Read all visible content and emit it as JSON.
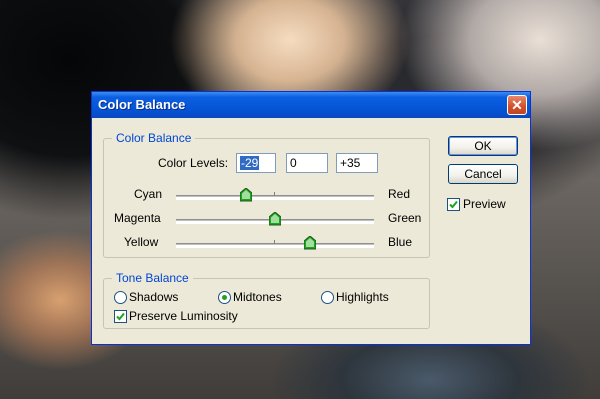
{
  "dialog": {
    "title": "Color Balance",
    "close_icon": "close-icon"
  },
  "color_balance": {
    "group_label": "Color Balance",
    "levels_label": "Color Levels:",
    "levels": [
      "-29",
      "0",
      "+35"
    ],
    "sliders": [
      {
        "left": "Cyan",
        "right": "Red",
        "value": -29
      },
      {
        "left": "Magenta",
        "right": "Green",
        "value": 0
      },
      {
        "left": "Yellow",
        "right": "Blue",
        "value": 35
      }
    ],
    "slider_range": [
      -100,
      100
    ]
  },
  "tone_balance": {
    "group_label": "Tone Balance",
    "options": [
      "Shadows",
      "Midtones",
      "Highlights"
    ],
    "selected": "Midtones",
    "preserve_label": "Preserve Luminosity",
    "preserve_checked": true
  },
  "buttons": {
    "ok": "OK",
    "cancel": "Cancel",
    "preview_label": "Preview",
    "preview_checked": true
  },
  "colors": {
    "title_bar": "#0553d5",
    "dialog_bg": "#ece9d8",
    "group_label": "#0046d5",
    "selection": "#316ac5",
    "thumb": "#21a121"
  }
}
